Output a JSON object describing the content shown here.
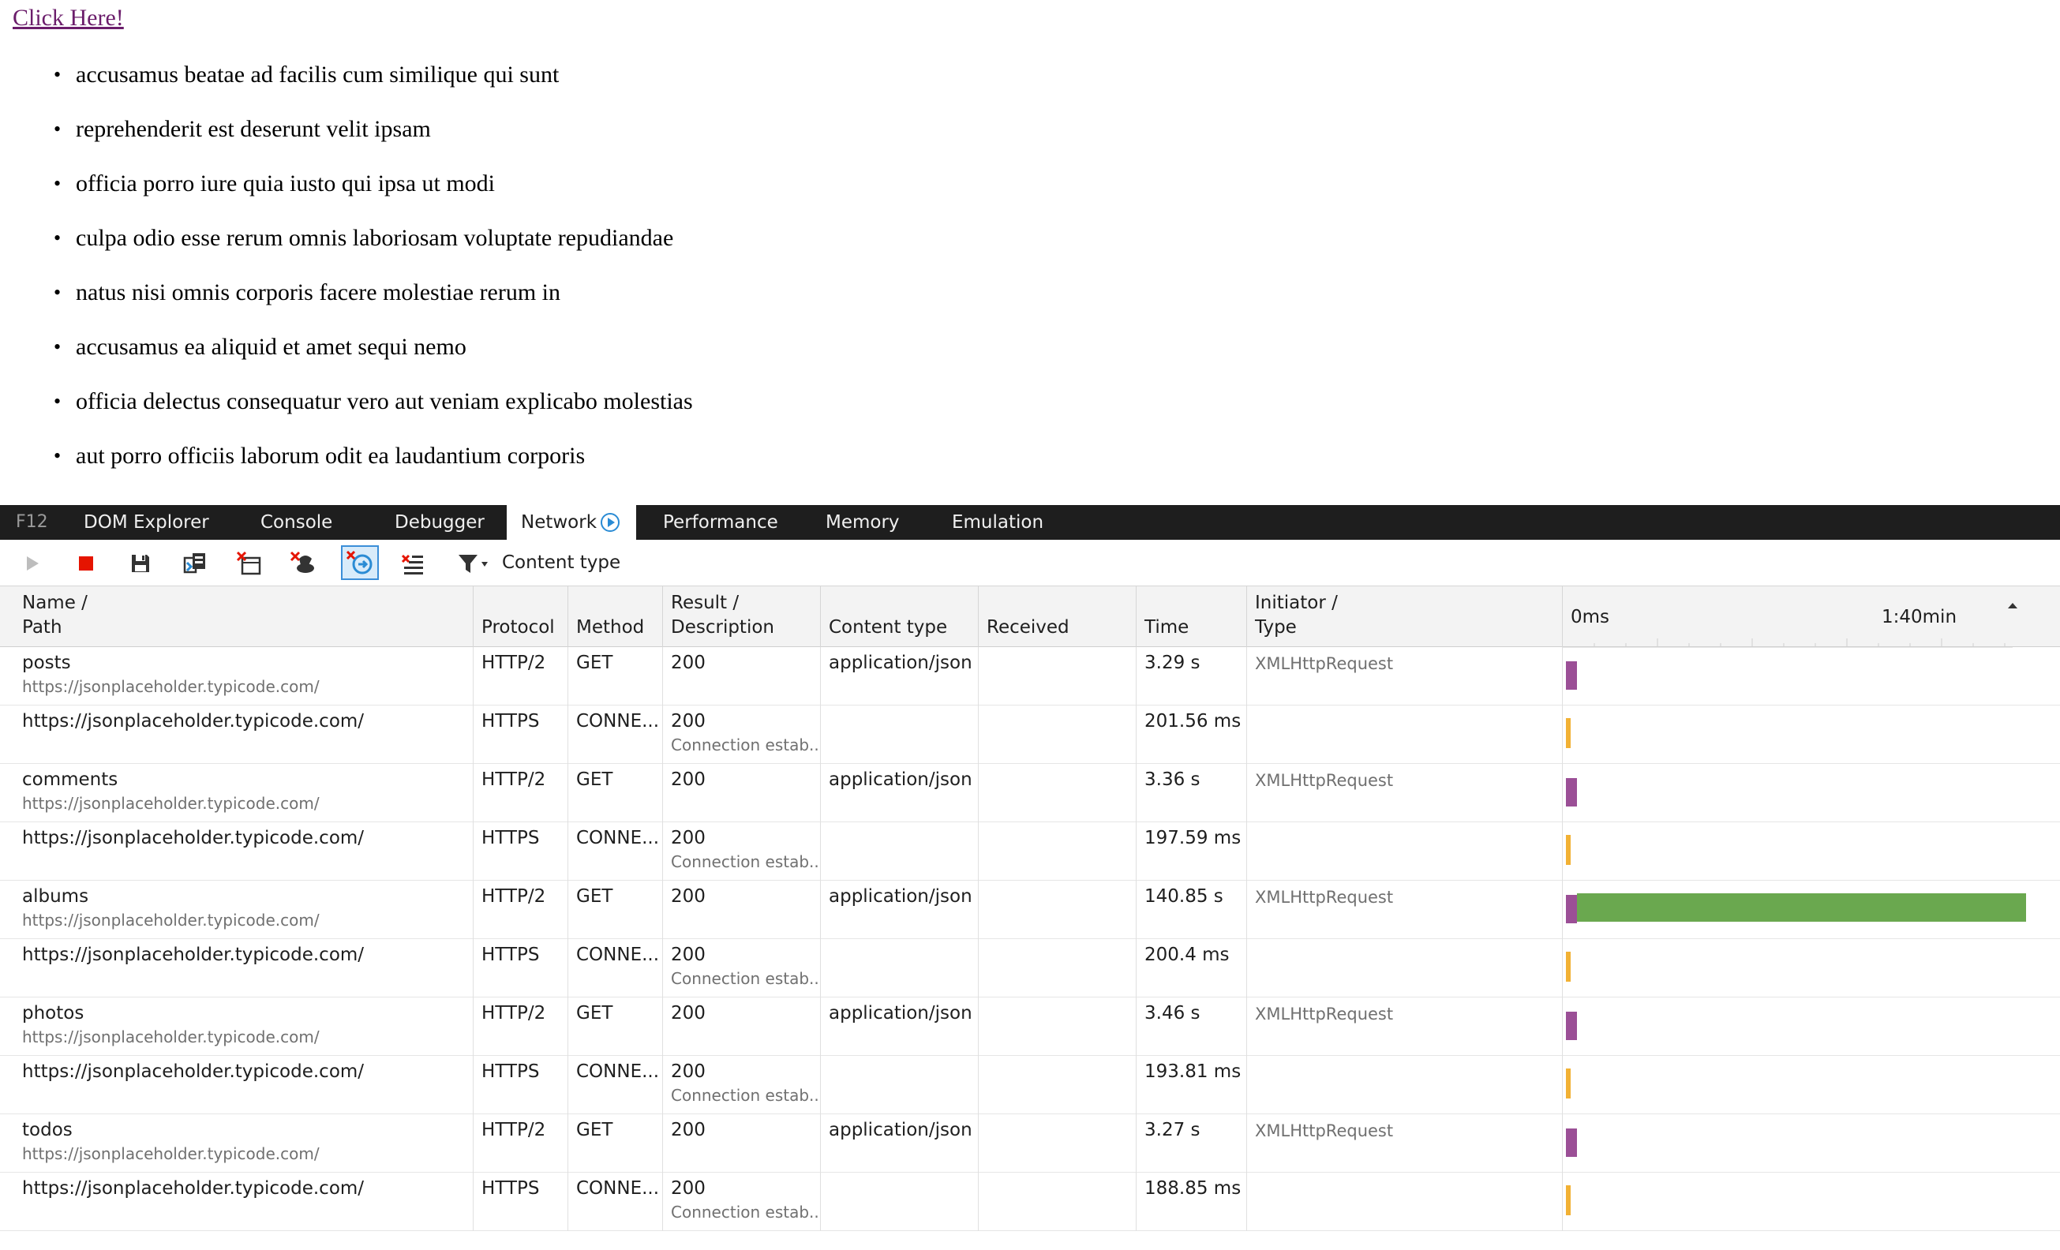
{
  "page": {
    "link_text": "Click Here!",
    "items": [
      "accusamus beatae ad facilis cum similique qui sunt",
      "reprehenderit est deserunt velit ipsam",
      "officia porro iure quia iusto qui ipsa ut modi",
      "culpa odio esse rerum omnis laboriosam voluptate repudiandae",
      "natus nisi omnis corporis facere molestiae rerum in",
      "accusamus ea aliquid et amet sequi nemo",
      "officia delectus consequatur vero aut veniam explicabo molestias",
      "aut porro officiis laborum odit ea laudantium corporis"
    ]
  },
  "devtools": {
    "tabs": {
      "f12": "F12",
      "dom_explorer": "DOM Explorer",
      "console": "Console",
      "debugger": "Debugger",
      "network": "Network",
      "performance": "Performance",
      "memory": "Memory",
      "emulation": "Emulation"
    },
    "active_tab": "Network",
    "toolbar": {
      "filter_label": "Content type",
      "icons": [
        "play-icon",
        "stop-icon",
        "save-icon",
        "export-icon",
        "clear-entries-icon",
        "clear-cache-icon",
        "always-refresh-icon",
        "clear-session-icon",
        "filter-icon"
      ]
    },
    "columns": {
      "name": [
        "Name /",
        "Path"
      ],
      "protocol": "Protocol",
      "method": "Method",
      "result": [
        "Result /",
        "Description"
      ],
      "content_type": "Content type",
      "received": "Received",
      "time": "Time",
      "initiator": [
        "Initiator /",
        "Type"
      ],
      "timeline_start": "0ms",
      "timeline_mid": "1:40min"
    },
    "colors": {
      "request_bar": "#9b4f96",
      "connect_bar": "#f2b134",
      "download_bar": "#6aa84f"
    },
    "rows": [
      {
        "name": "posts",
        "path": "https://jsonplaceholder.typicode.com/",
        "protocol": "HTTP/2",
        "method": "GET",
        "result": "200",
        "description": "",
        "content_type": "application/json",
        "received": "",
        "time": "3.29 s",
        "initiator": "XMLHttpRequest",
        "kind": "request",
        "duration_s": 3.29
      },
      {
        "name": "https://jsonplaceholder.typicode.com/",
        "path": "",
        "protocol": "HTTPS",
        "method": "CONNE...",
        "result": "200",
        "description": "Connection estab...",
        "content_type": "",
        "received": "",
        "time": "201.56 ms",
        "initiator": "",
        "kind": "connect",
        "duration_s": 0.20156
      },
      {
        "name": "comments",
        "path": "https://jsonplaceholder.typicode.com/",
        "protocol": "HTTP/2",
        "method": "GET",
        "result": "200",
        "description": "",
        "content_type": "application/json",
        "received": "",
        "time": "3.36 s",
        "initiator": "XMLHttpRequest",
        "kind": "request",
        "duration_s": 3.36
      },
      {
        "name": "https://jsonplaceholder.typicode.com/",
        "path": "",
        "protocol": "HTTPS",
        "method": "CONNE...",
        "result": "200",
        "description": "Connection estab...",
        "content_type": "",
        "received": "",
        "time": "197.59 ms",
        "initiator": "",
        "kind": "connect",
        "duration_s": 0.19759
      },
      {
        "name": "albums",
        "path": "https://jsonplaceholder.typicode.com/",
        "protocol": "HTTP/2",
        "method": "GET",
        "result": "200",
        "description": "",
        "content_type": "application/json",
        "received": "",
        "time": "140.85 s",
        "initiator": "XMLHttpRequest",
        "kind": "request",
        "duration_s": 140.85
      },
      {
        "name": "https://jsonplaceholder.typicode.com/",
        "path": "",
        "protocol": "HTTPS",
        "method": "CONNE...",
        "result": "200",
        "description": "Connection estab...",
        "content_type": "",
        "received": "",
        "time": "200.4 ms",
        "initiator": "",
        "kind": "connect",
        "duration_s": 0.2004
      },
      {
        "name": "photos",
        "path": "https://jsonplaceholder.typicode.com/",
        "protocol": "HTTP/2",
        "method": "GET",
        "result": "200",
        "description": "",
        "content_type": "application/json",
        "received": "",
        "time": "3.46 s",
        "initiator": "XMLHttpRequest",
        "kind": "request",
        "duration_s": 3.46
      },
      {
        "name": "https://jsonplaceholder.typicode.com/",
        "path": "",
        "protocol": "HTTPS",
        "method": "CONNE...",
        "result": "200",
        "description": "Connection estab...",
        "content_type": "",
        "received": "",
        "time": "193.81 ms",
        "initiator": "",
        "kind": "connect",
        "duration_s": 0.19381
      },
      {
        "name": "todos",
        "path": "https://jsonplaceholder.typicode.com/",
        "protocol": "HTTP/2",
        "method": "GET",
        "result": "200",
        "description": "",
        "content_type": "application/json",
        "received": "",
        "time": "3.27 s",
        "initiator": "XMLHttpRequest",
        "kind": "request",
        "duration_s": 3.27
      },
      {
        "name": "https://jsonplaceholder.typicode.com/",
        "path": "",
        "protocol": "HTTPS",
        "method": "CONNE...",
        "result": "200",
        "description": "Connection estab...",
        "content_type": "",
        "received": "",
        "time": "188.85 ms",
        "initiator": "",
        "kind": "connect",
        "duration_s": 0.18885
      }
    ]
  }
}
